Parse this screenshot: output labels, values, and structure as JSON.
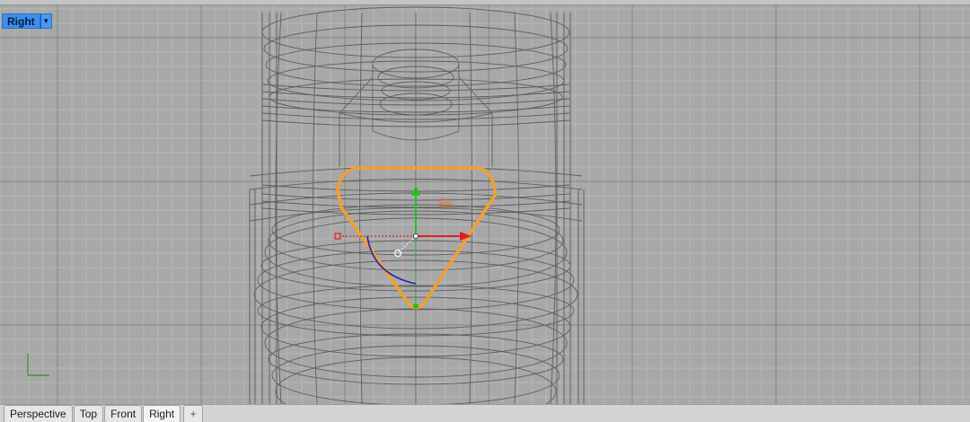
{
  "viewport": {
    "title": "Right",
    "title_dropdown_icon": "chevron-down-icon",
    "background": "#a8a8a8",
    "grid_minor_color": "#bcbcbc",
    "grid_major_color": "#7a8a7a",
    "wireframe_color": "#5e5e5e",
    "selected_curve_color": "#f0a030",
    "gumball": {
      "x_axis_color": "#e02020",
      "y_axis_color": "#20c020",
      "rotation_arc_color": "#2020c0",
      "scale_handle_color": "#e07030"
    }
  },
  "tabs": {
    "items": [
      {
        "label": "Perspective"
      },
      {
        "label": "Top"
      },
      {
        "label": "Front"
      },
      {
        "label": "Right"
      }
    ],
    "add_icon": "plus-icon",
    "add_label": "+"
  }
}
